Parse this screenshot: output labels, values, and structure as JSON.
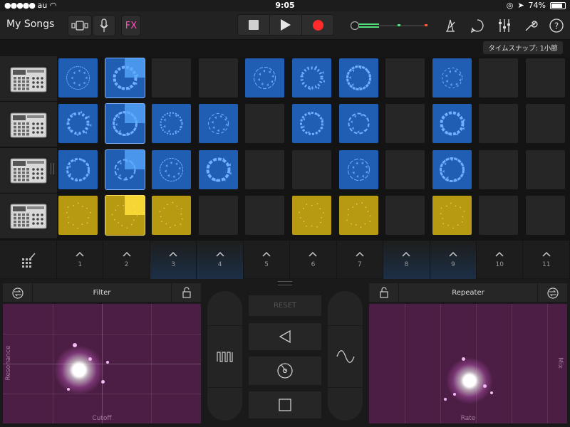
{
  "status": {
    "carrier": "au",
    "time": "9:05",
    "battery": "74%"
  },
  "header": {
    "title": "My Songs",
    "fx_label": "FX"
  },
  "snap_label": "タイムスナップ: 1小節",
  "tracks": [
    {
      "name": "drum-machine-1",
      "cells": [
        "blue",
        "blue-active",
        "empty",
        "empty",
        "blue",
        "blue",
        "blue",
        "empty",
        "blue",
        "empty",
        "empty"
      ]
    },
    {
      "name": "drum-machine-2",
      "cells": [
        "blue",
        "blue-active",
        "blue",
        "blue",
        "empty",
        "blue",
        "blue",
        "empty",
        "blue",
        "empty",
        "empty"
      ]
    },
    {
      "name": "drum-machine-3",
      "cells": [
        "blue",
        "blue-active",
        "blue",
        "blue",
        "empty",
        "empty",
        "blue",
        "empty",
        "blue",
        "empty",
        "empty"
      ]
    },
    {
      "name": "drum-machine-4",
      "cells": [
        "yellow",
        "yellow-active",
        "yellow",
        "empty",
        "empty",
        "yellow",
        "yellow",
        "empty",
        "yellow",
        "empty",
        "empty"
      ]
    }
  ],
  "columns": [
    "1",
    "2",
    "3",
    "4",
    "5",
    "6",
    "7",
    "8",
    "9",
    "10",
    "11"
  ],
  "highlighted_columns": [
    "3",
    "4",
    "8",
    "9"
  ],
  "left_pad": {
    "title": "Filter",
    "x_label": "Cutoff",
    "y_label": "Resonance"
  },
  "right_pad": {
    "title": "Repeater",
    "x_label": "Rate",
    "y_label": "Mix"
  },
  "center": {
    "reset_label": "RESET"
  },
  "colors": {
    "accent_pink": "#ff4fb8",
    "record": "#ff2a2a",
    "cell_blue": "#1f5eb3",
    "cell_yellow": "#b89a12",
    "pad_purple": "#4d1e45"
  }
}
